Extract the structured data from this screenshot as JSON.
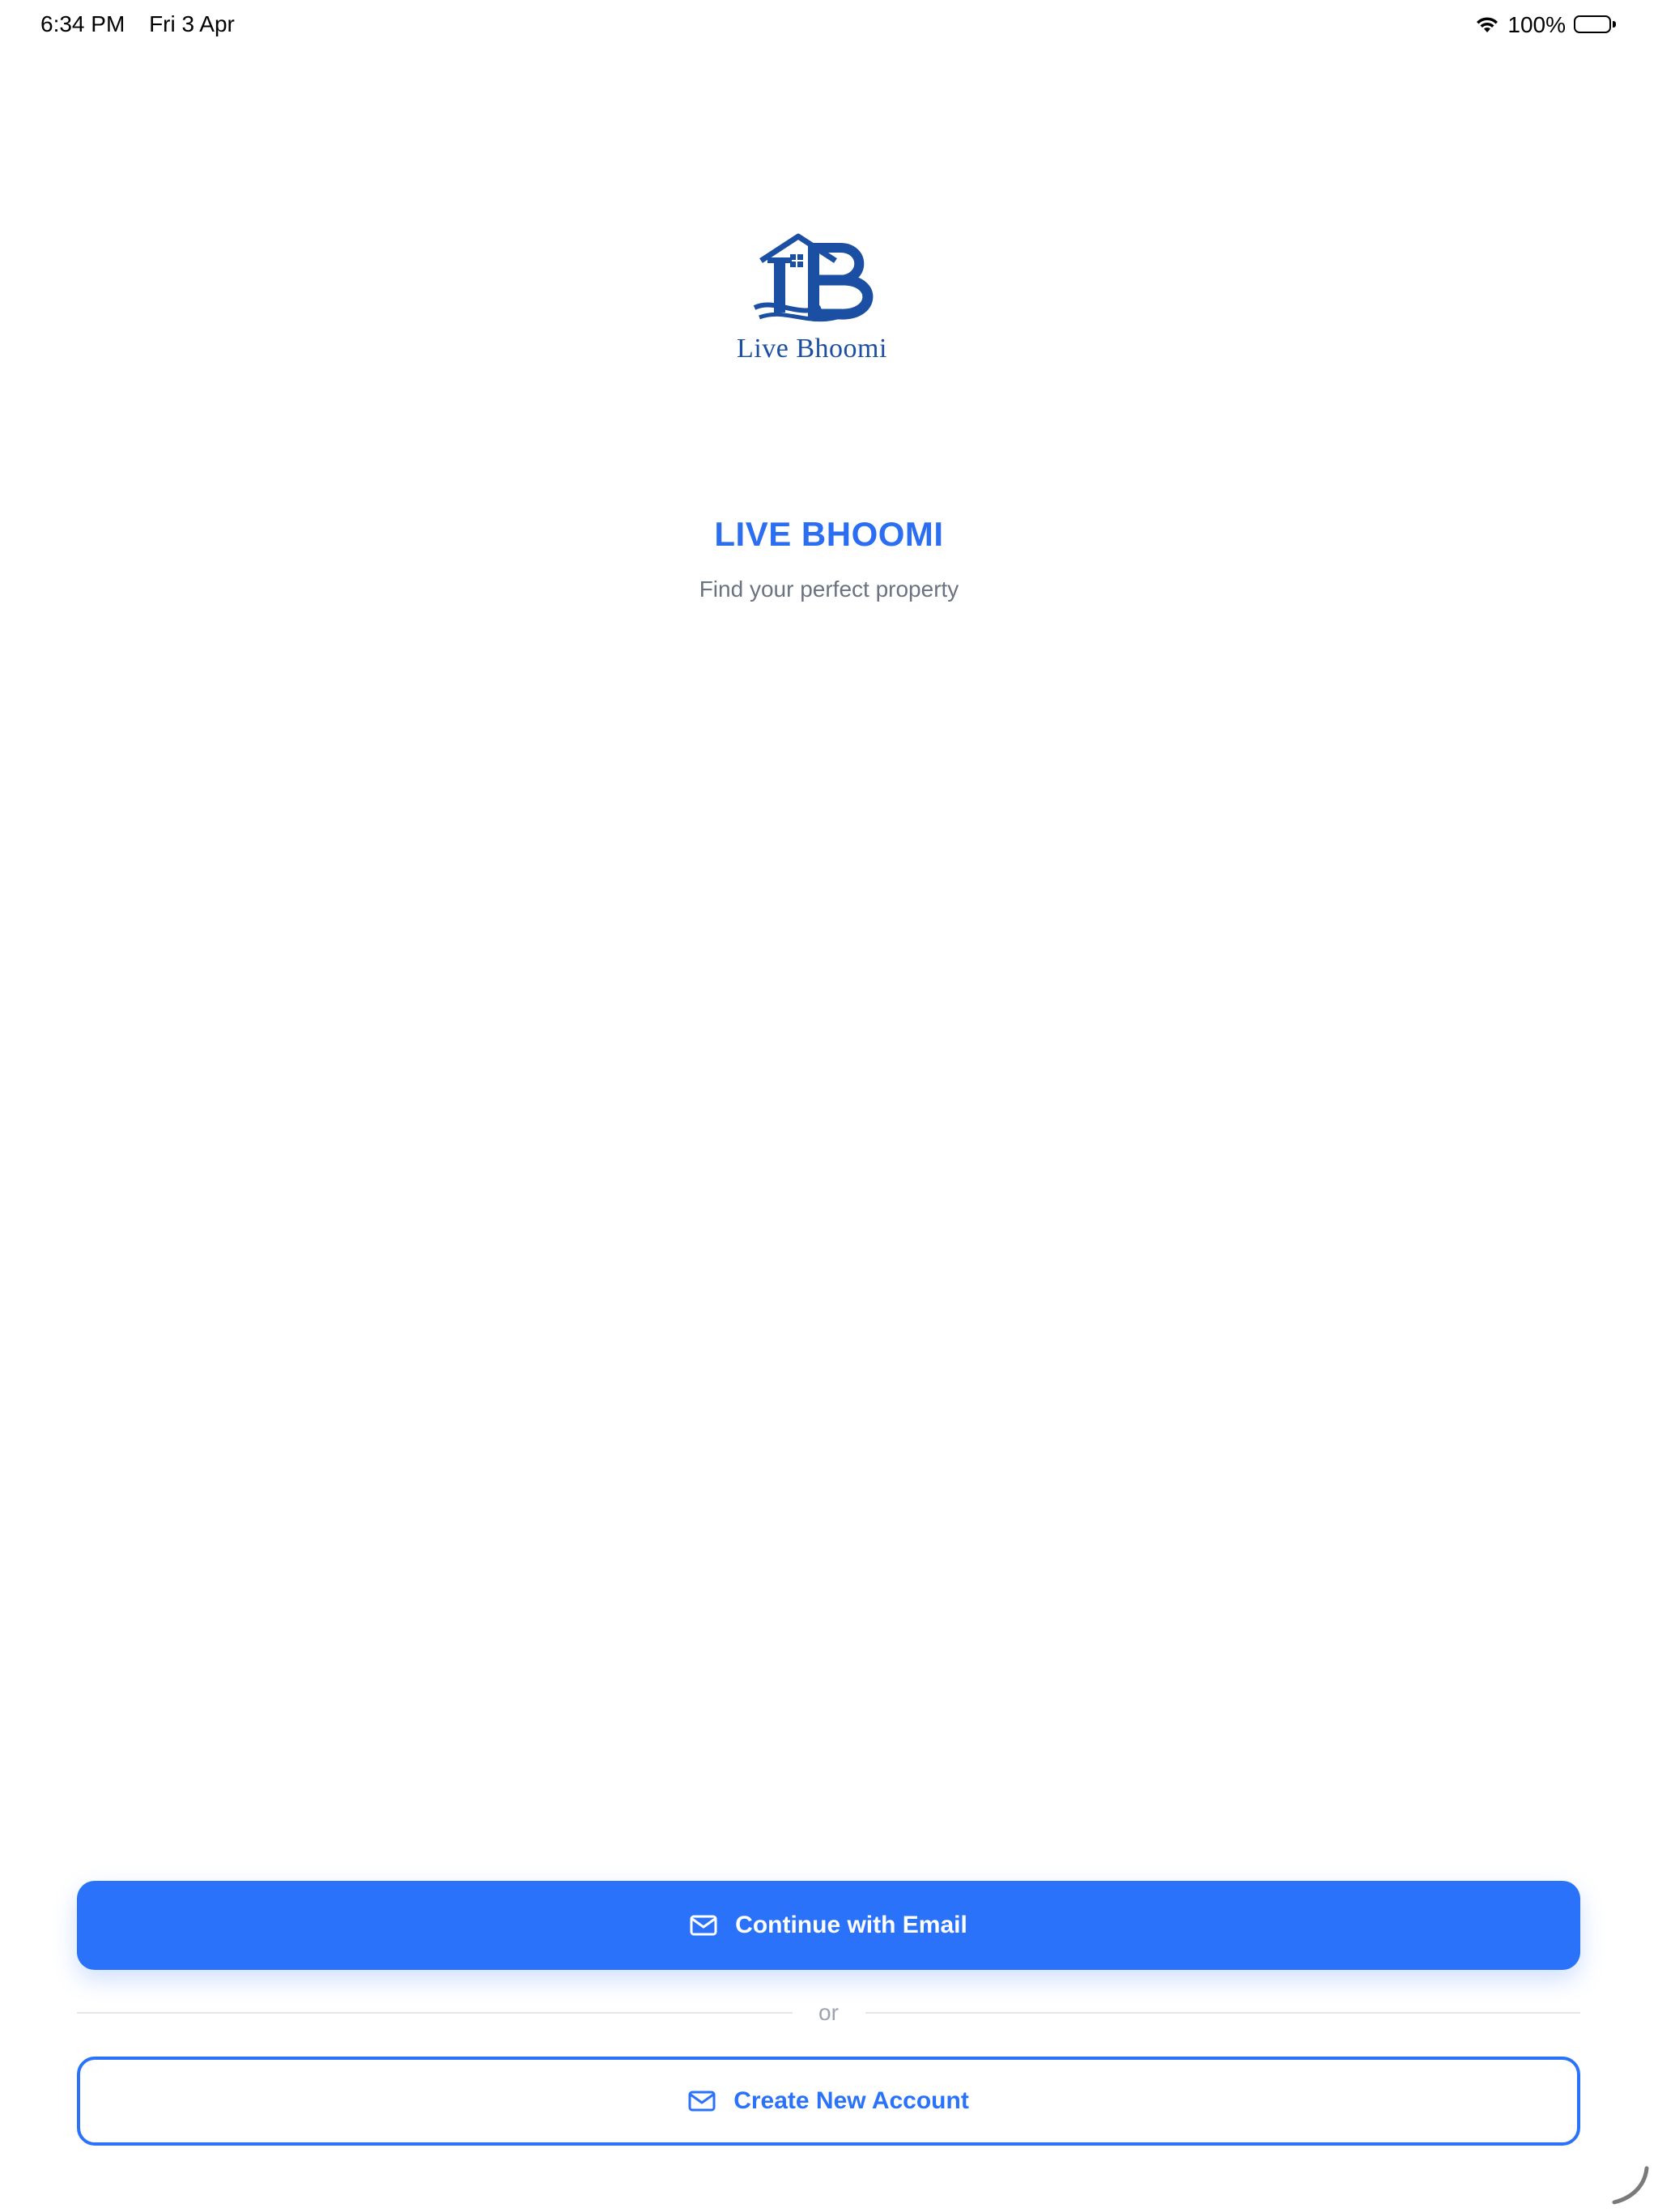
{
  "status_bar": {
    "time": "6:34 PM",
    "date": "Fri 3 Apr",
    "battery_percent": "100%",
    "wifi_icon": "wifi-icon",
    "battery_icon": "battery-icon"
  },
  "logo": {
    "icon": "live-bhoomi-logo",
    "text": "Live Bhoomi"
  },
  "header": {
    "title": "LIVE BHOOMI",
    "subtitle": "Find your perfect property"
  },
  "actions": {
    "continue_email_label": "Continue with Email",
    "divider_label": "or",
    "create_account_label": "Create New Account",
    "icon": "mail-icon"
  },
  "colors": {
    "primary": "#2b72fb",
    "title": "#2b6ef2",
    "subtitle": "#6b7280",
    "logo": "#1a4fa3"
  }
}
